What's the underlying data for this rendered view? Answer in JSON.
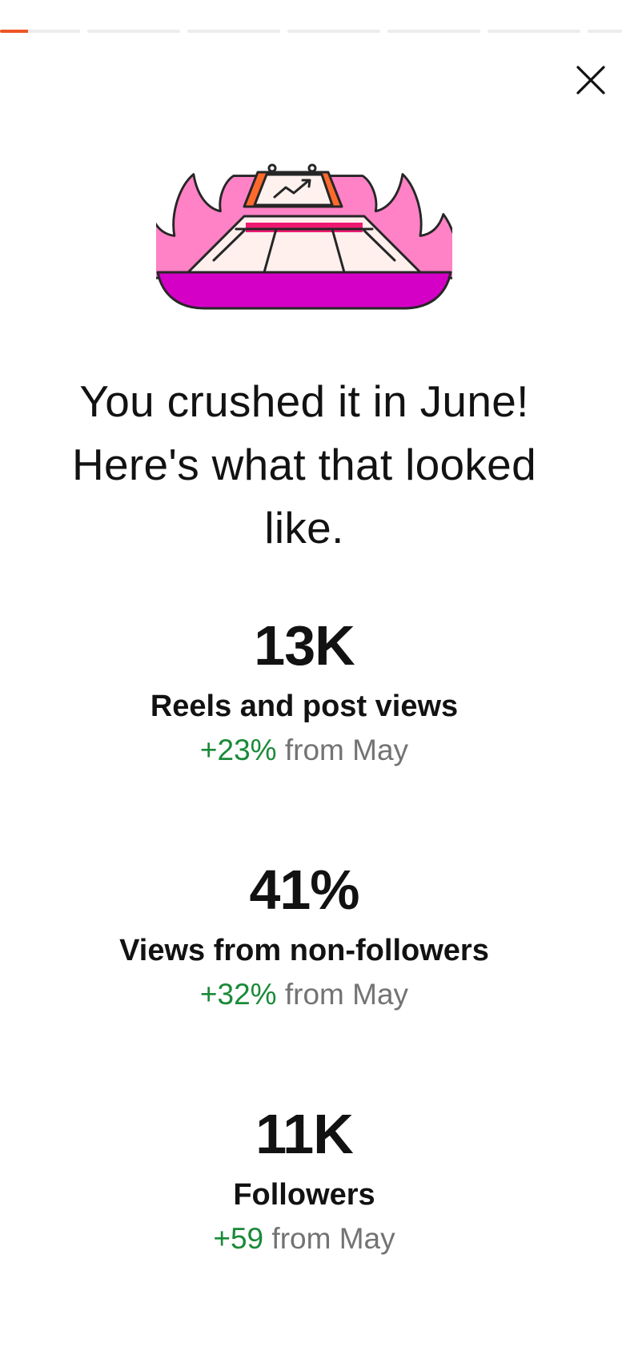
{
  "progress": {
    "segments": [
      {
        "fill": 0.35,
        "active": true
      },
      {
        "fill": 0
      },
      {
        "fill": 0
      },
      {
        "fill": 0
      },
      {
        "fill": 0
      },
      {
        "fill": 0
      },
      {
        "fill": 0
      }
    ],
    "accent_color": "#ee5626"
  },
  "close": {
    "icon": "close-icon"
  },
  "illustration": {
    "icon": "trending-chart-fire-icon"
  },
  "headline": "You crushed it in June! Here's what that looked like.",
  "stats": [
    {
      "value": "13K",
      "label": "Reels and post views",
      "delta": "+23%",
      "suffix": "from May"
    },
    {
      "value": "41%",
      "label": "Views from non-followers",
      "delta": "+32%",
      "suffix": "from May"
    },
    {
      "value": "11K",
      "label": "Followers",
      "delta": "+59",
      "suffix": "from May"
    }
  ],
  "colors": {
    "positive": "#1a8a38",
    "muted": "#737373",
    "text": "#121212"
  }
}
